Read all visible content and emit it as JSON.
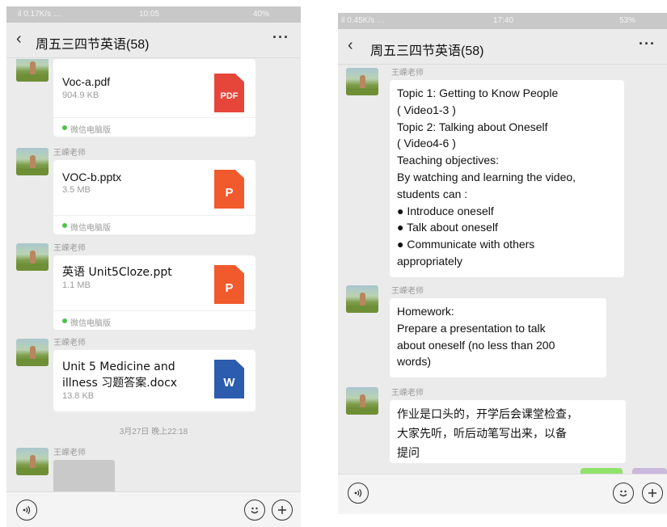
{
  "left": {
    "status": {
      "network": " il 0.17K/s …",
      "time": "10:05",
      "battery": "40%"
    },
    "nav": {
      "title": "周五三四节英语(58)",
      "more": "···"
    },
    "files": [
      {
        "name": "Voc-a.pdf",
        "size": "904.9 KB",
        "icon_text": "PDF",
        "source": "微信电脑版"
      },
      {
        "sender": "王嵘老师",
        "name": "VOC-b.pptx",
        "size": "3.5 MB",
        "icon_text": "P",
        "source": "微信电脑版"
      },
      {
        "sender": "王嵘老师",
        "name": "英语 Unit5Cloze.ppt",
        "size": "1.1 MB",
        "icon_text": "P",
        "source": "微信电脑版"
      },
      {
        "sender": "王嵘老师",
        "name": "Unit 5 Medicine and illness 习题答案.docx",
        "size": "13.8 KB",
        "icon_text": "W"
      }
    ],
    "timestamp": "3月27日 晚上22:18",
    "last_sender": "王嵘老师"
  },
  "right": {
    "status": {
      "network": "il 0.45K/s …",
      "time": "17:40",
      "battery": "53%"
    },
    "nav": {
      "title": "周五三四节英语(58)",
      "more": "···"
    },
    "messages": [
      {
        "sender": "王嵘老师",
        "lines": [
          "Topic 1: Getting to Know People",
          "( Video1-3 )",
          "Topic 2: Talking about Oneself",
          "( Video4-6 )",
          " Teaching objectives:",
          "By watching and learning the video,",
          "students can :",
          "● Introduce oneself",
          "● Talk about oneself",
          "● Communicate with others",
          "appropriately"
        ]
      },
      {
        "sender": "王嵘老师",
        "lines": [
          "Homework:",
          " Prepare a presentation to talk",
          "about oneself (no less than 200",
          "words)"
        ]
      },
      {
        "sender": "王嵘老师",
        "lines": [
          "作业是口头的，开学后会课堂检查，",
          "大家先听，听后动笔写出来，以备",
          "提问"
        ]
      }
    ]
  },
  "colors": {
    "chat_bg": "#ebebeb",
    "status_bar": "#c8c8c8",
    "pdf_red": "#e6463a",
    "ppt_orange": "#f05a2c",
    "word_blue": "#2b5cad",
    "source_green": "#4fc24a"
  },
  "icons": [
    "back-chevron-icon",
    "more-icon",
    "voice-icon",
    "emoji-icon",
    "plus-icon",
    "pdf-icon",
    "ppt-icon",
    "word-icon"
  ]
}
